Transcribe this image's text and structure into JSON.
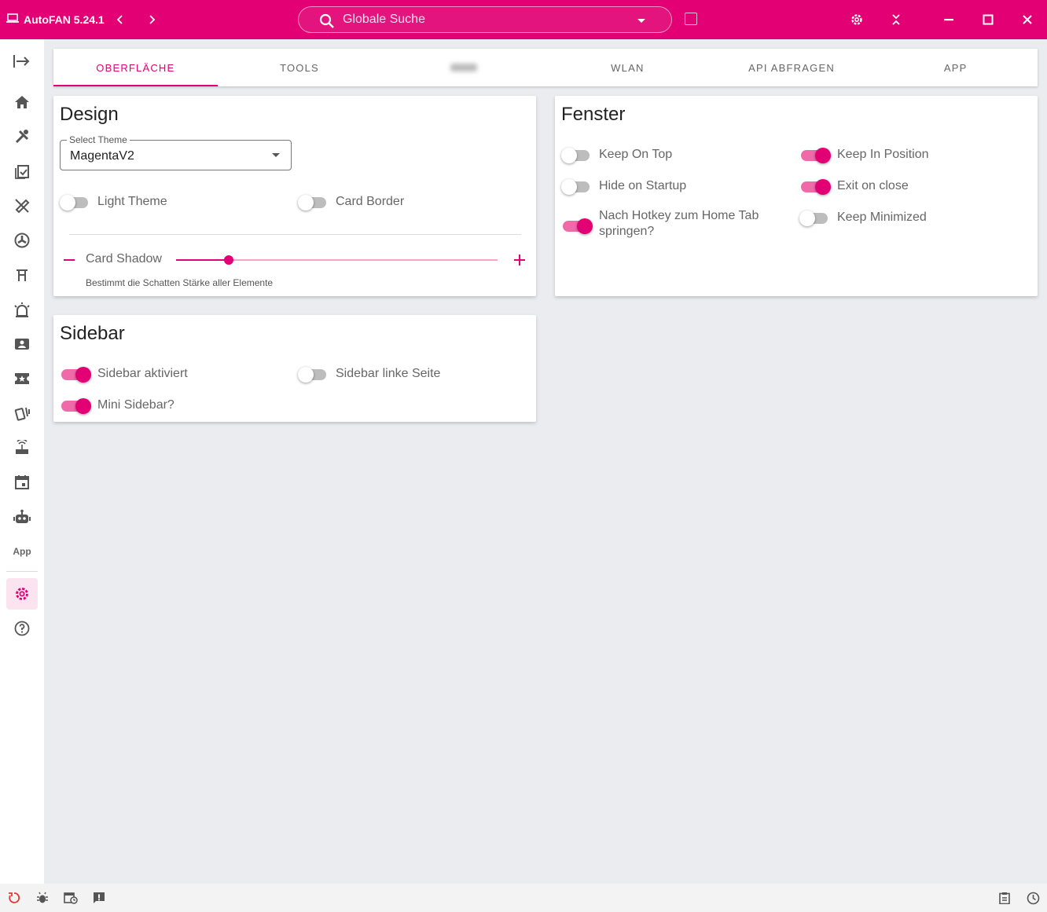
{
  "titlebar": {
    "app_title": "AutoFAN 5.24.1",
    "search_placeholder": "Globale Suche"
  },
  "sidebar": {
    "app_label": "App",
    "items": [
      "exit-to-app-icon",
      "home-icon",
      "tools-icon",
      "clipboard-check-icon",
      "phone-off-icon",
      "fan-icon",
      "pins-icon",
      "alarm-light-icon",
      "account-box-icon",
      "ticket-icon",
      "cards-icon",
      "router-icon",
      "calendar-icon",
      "robot-icon",
      "app",
      "settings-icon",
      "help-icon"
    ]
  },
  "tabs": [
    {
      "label": "OBERFLÄCHE",
      "active": true
    },
    {
      "label": "TOOLS",
      "active": false
    },
    {
      "label": "",
      "active": false,
      "blurred": true
    },
    {
      "label": "WLAN",
      "active": false
    },
    {
      "label": "API ABFRAGEN",
      "active": false
    },
    {
      "label": "APP",
      "active": false
    }
  ],
  "design": {
    "title": "Design",
    "select_label": "Select Theme",
    "select_value": "MagentaV2",
    "light_theme": {
      "label": "Light Theme",
      "on": false
    },
    "card_border": {
      "label": "Card Border",
      "on": false
    },
    "card_shadow": {
      "label": "Card Shadow",
      "value": 0.165,
      "hint": "Bestimmt die Schatten Stärke aller Elemente"
    }
  },
  "fenster": {
    "title": "Fenster",
    "keep_on_top": {
      "label": "Keep On Top",
      "on": false
    },
    "keep_in_position": {
      "label": "Keep In Position",
      "on": true
    },
    "hide_on_startup": {
      "label": "Hide on Startup",
      "on": false
    },
    "exit_on_close": {
      "label": "Exit on close",
      "on": true
    },
    "hotkey_home": {
      "label": "Nach Hotkey zum Home Tab springen?",
      "on": true
    },
    "keep_minimized": {
      "label": "Keep Minimized",
      "on": false
    }
  },
  "sidebar_card": {
    "title": "Sidebar",
    "sidebar_enabled": {
      "label": "Sidebar aktiviert",
      "on": true
    },
    "sidebar_left": {
      "label": "Sidebar linke Seite",
      "on": false
    },
    "mini_sidebar": {
      "label": "Mini Sidebar?",
      "on": true
    }
  },
  "colors": {
    "accent": "#e20074",
    "accent_light": "#f06aa9",
    "background": "#ebecf0"
  }
}
